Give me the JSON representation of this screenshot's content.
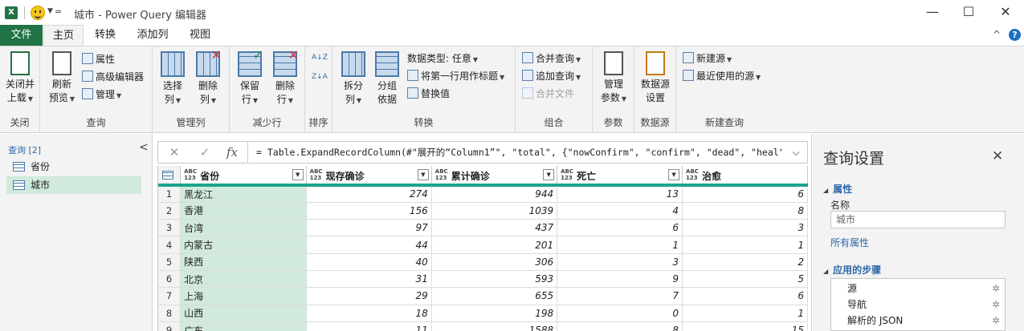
{
  "titlebar": {
    "app_icon": "X",
    "separator_char": "=",
    "title": "城市 - Power Query 编辑器",
    "controls": [
      "—",
      "☐",
      "✕"
    ]
  },
  "tabs": {
    "items": [
      "文件",
      "主页",
      "转换",
      "添加列",
      "视图"
    ],
    "active": "主页",
    "right_caret": "^",
    "help": "?"
  },
  "ribbon": {
    "groups": {
      "close": {
        "label": "关闭",
        "btn_line1": "关闭并",
        "btn_line2": "上载"
      },
      "query": {
        "label": "查询",
        "refresh_line1": "刷新",
        "refresh_line2": "预览",
        "properties": "属性",
        "advanced": "高级编辑器",
        "manage": "管理"
      },
      "manage_cols": {
        "label": "管理列",
        "choose_line1": "选择",
        "choose_line2": "列",
        "remove_line1": "删除",
        "remove_line2": "列"
      },
      "reduce_rows": {
        "label": "减少行",
        "keep_line1": "保留",
        "keep_line2": "行",
        "remove_line1": "删除",
        "remove_line2": "行"
      },
      "sort": {
        "label": "排序",
        "asc": "A↓Z",
        "desc": "Z↓A"
      },
      "transform": {
        "label": "转换",
        "split_line1": "拆分",
        "split_line2": "列",
        "group_line1": "分组",
        "group_line2": "依据",
        "datatype": "数据类型: 任意",
        "first_row": "将第一行用作标题",
        "replace": "替换值"
      },
      "combine": {
        "label": "组合",
        "merge": "合并查询",
        "append": "追加查询",
        "combine_files": "合并文件"
      },
      "params": {
        "label": "参数",
        "line1": "管理",
        "line2": "参数"
      },
      "datasource": {
        "label": "数据源",
        "line1": "数据源",
        "line2": "设置"
      },
      "newquery": {
        "label": "新建查询",
        "new_source": "新建源",
        "recent": "最近使用的源"
      }
    }
  },
  "queries": {
    "header": "查询 [2]",
    "collapse": "<",
    "items": [
      {
        "label": "省份",
        "selected": false
      },
      {
        "label": "城市",
        "selected": true
      }
    ]
  },
  "formula": {
    "cancel": "✕",
    "confirm": "✓",
    "fx": "fx",
    "text": "= Table.ExpandRecordColumn(#\"展开的“Column1”\", \"total\", {\"nowConfirm\", \"confirm\", \"dead\", \"heal\"},",
    "expand": "⌵"
  },
  "grid": {
    "type_label_top": "ABC",
    "type_label_bottom": "123",
    "columns": [
      "省份",
      "现存确诊",
      "累计确诊",
      "死亡",
      "治愈"
    ],
    "rows": [
      [
        "1",
        "黑龙江",
        "274",
        "944",
        "13",
        "6"
      ],
      [
        "2",
        "香港",
        "156",
        "1039",
        "4",
        "8"
      ],
      [
        "3",
        "台湾",
        "97",
        "437",
        "6",
        "3"
      ],
      [
        "4",
        "内蒙古",
        "44",
        "201",
        "1",
        "1"
      ],
      [
        "5",
        "陕西",
        "40",
        "306",
        "3",
        "2"
      ],
      [
        "6",
        "北京",
        "31",
        "593",
        "9",
        "5"
      ],
      [
        "7",
        "上海",
        "29",
        "655",
        "7",
        "6"
      ],
      [
        "8",
        "山西",
        "18",
        "198",
        "0",
        "1"
      ],
      [
        "9",
        "广东",
        "11",
        "1588",
        "8",
        "15"
      ]
    ]
  },
  "settings": {
    "title": "查询设置",
    "close": "✕",
    "properties_header": "属性",
    "name_label": "名称",
    "name_value": "城市",
    "all_properties": "所有属性",
    "steps_header": "应用的步骤",
    "steps": [
      "源",
      "导航",
      "解析的 JSON"
    ]
  },
  "colors": {
    "excel_green": "#217346",
    "selection_green": "#d1eadb",
    "header_underline": "#1aa38a",
    "link_blue": "#2e6aa8"
  }
}
